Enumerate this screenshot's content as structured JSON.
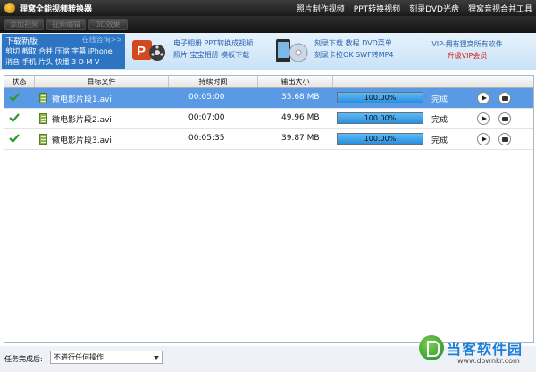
{
  "window": {
    "title": "狸窝全能视频转换器"
  },
  "topnav": [
    "照片制作视频",
    "PPT转换视频",
    "刻录DVD光盘",
    "狸窝音视合并工具"
  ],
  "toolbar": [
    "添加视频",
    "视频编辑",
    "3D效果"
  ],
  "banner": {
    "download": {
      "title": "下载新版",
      "online": "在线咨询>>",
      "line2": "剪切 截取 合并 压缩 字幕 iPhone",
      "line3": "消音 手机 片头 快播 3 D M V"
    },
    "promo1": {
      "line1": "电子相册 PPT转换成视频",
      "line2": "照片 宝宝相册 模板下载"
    },
    "promo2": {
      "line1": "刻录下载 教程 DVD菜单",
      "line2": "刻录卡拉OK SWF转MP4"
    },
    "vip": {
      "line1": "VIP-拥有狸窝所有软件",
      "line2": "升级VIP会员"
    }
  },
  "table": {
    "headers": [
      "状态",
      "目标文件",
      "持续时间",
      "输出大小"
    ],
    "rows": [
      {
        "file": "微电影片段1.avi",
        "duration": "00:05:00",
        "size": "35.68 MB",
        "progress_text": "100.00%",
        "progress": 1.0,
        "status": "完成",
        "selected": true
      },
      {
        "file": "微电影片段2.avi",
        "duration": "00:07:00",
        "size": "49.96 MB",
        "progress_text": "100.00%",
        "progress": 1.0,
        "status": "完成",
        "selected": false
      },
      {
        "file": "微电影片段3.avi",
        "duration": "00:05:35",
        "size": "39.87 MB",
        "progress_text": "100.00%",
        "progress": 1.0,
        "status": "完成",
        "selected": false
      }
    ]
  },
  "bottom": {
    "after_label": "任务完成后:",
    "after_value": "不进行任何操作"
  },
  "watermark": {
    "name": "当客软件园",
    "url": "www.downkr.com"
  },
  "colors": {
    "selected_row": "#5a9ae4",
    "progress": "#2a8fde",
    "check": "#2e9a2e"
  }
}
